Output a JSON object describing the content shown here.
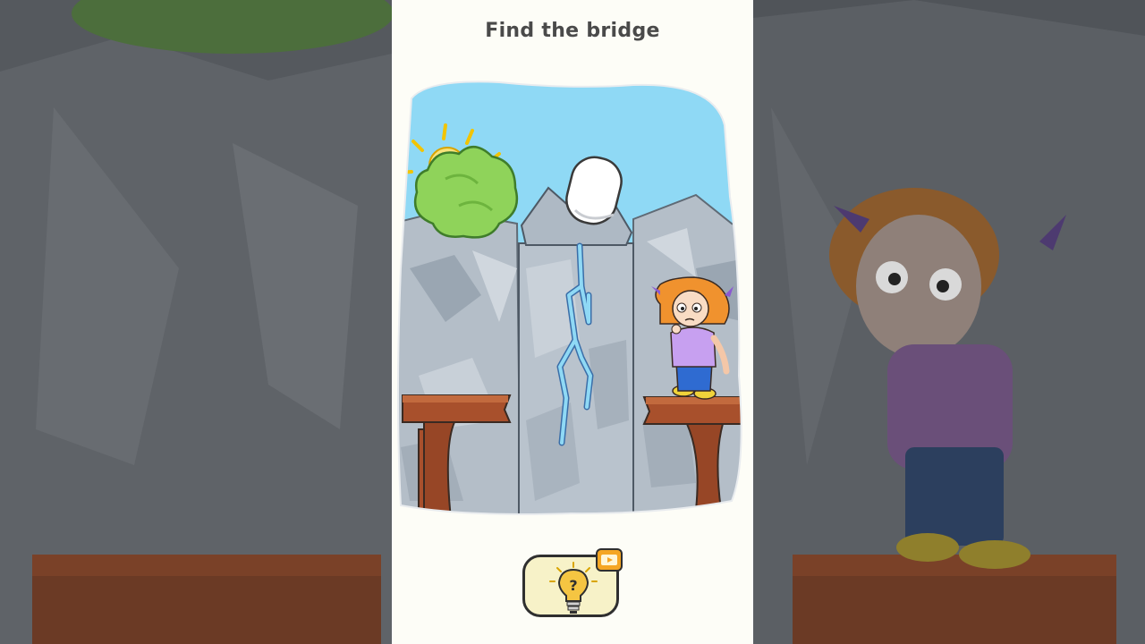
{
  "level": {
    "title": "Find the bridge"
  },
  "objects": {
    "bush": "green-bush",
    "sun": "sun",
    "stone": "white-stone",
    "girl": "worried-girl",
    "left_ledge": "left-wooden-ledge",
    "right_ledge": "right-wooden-ledge",
    "crack": "blue-crack"
  },
  "hint": {
    "icon": "lightbulb-question-icon",
    "badge_icon": "video-ad-icon"
  },
  "colors": {
    "sky": "#8fd9f5",
    "rock": "#b9c3cd",
    "ledge": "#a8502c",
    "bush": "#8fd35a",
    "hint_bg": "#f7f2c8",
    "badge": "#f5a623"
  }
}
